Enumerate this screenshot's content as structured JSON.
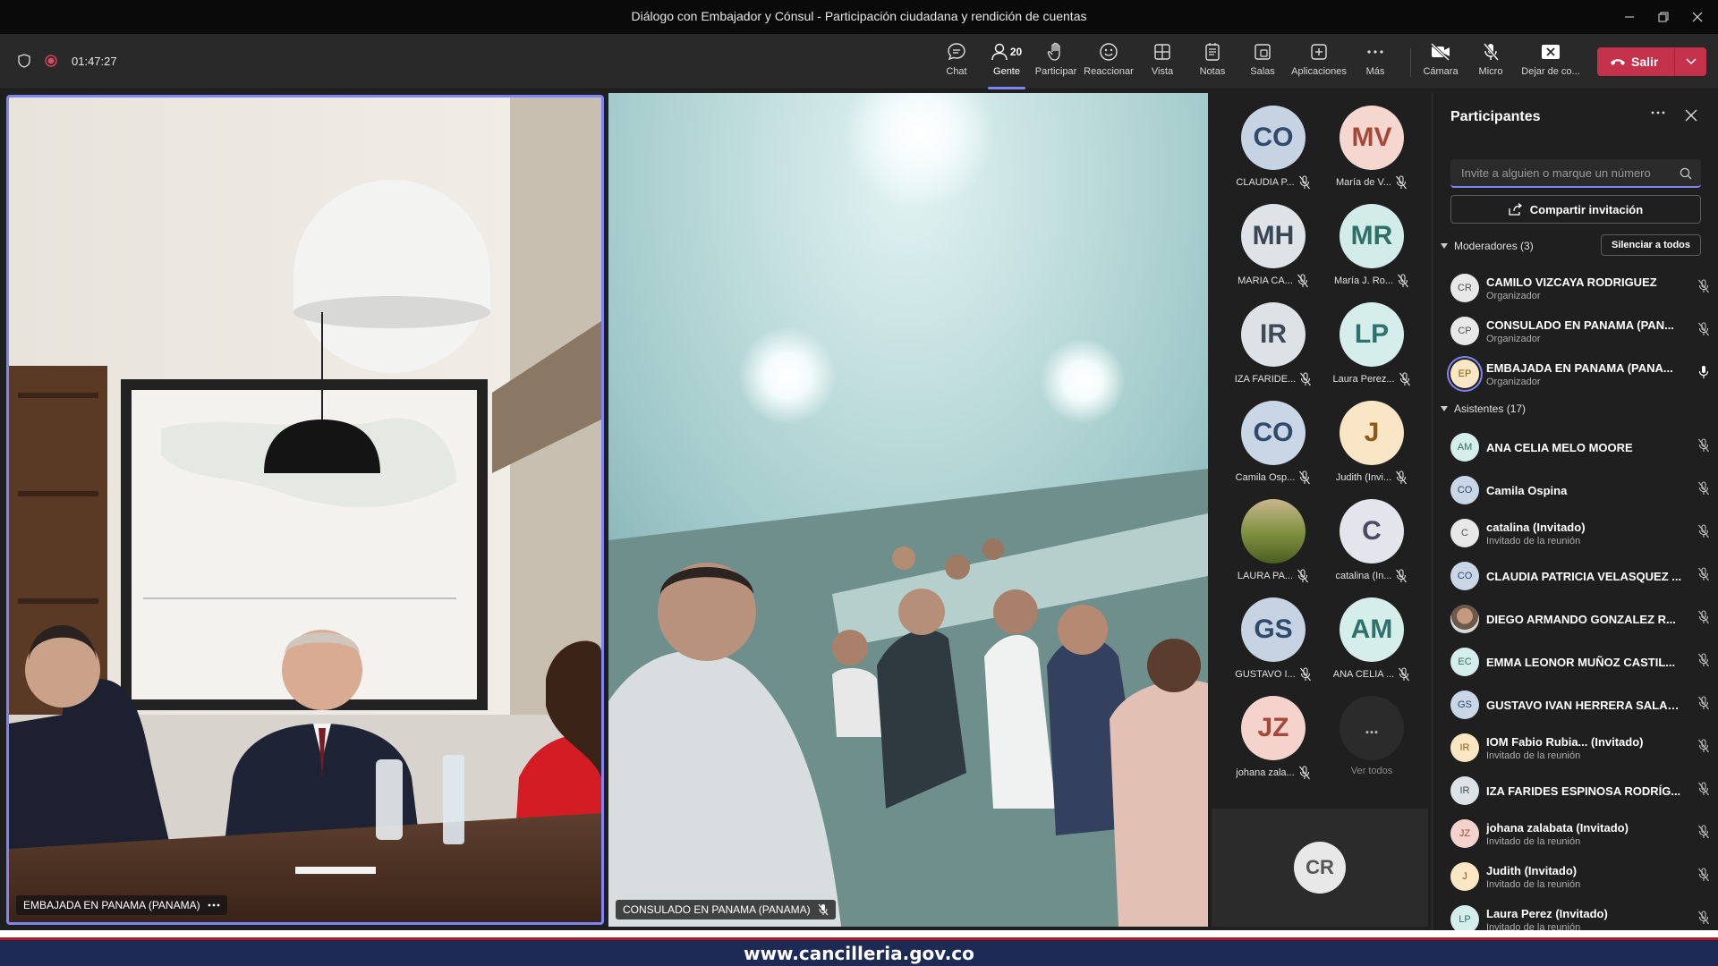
{
  "window": {
    "title": "Diálogo con Embajador y Cónsul - Participación ciudadana y rendición de cuentas"
  },
  "meeting": {
    "timer": "01:47:27"
  },
  "toolbar": {
    "chat": "Chat",
    "people": "Gente",
    "people_count": "20",
    "raise_hand": "Participar",
    "react": "Reaccionar",
    "view": "Vista",
    "notes": "Notas",
    "rooms": "Salas",
    "apps": "Aplicaciones",
    "more": "Más",
    "camera": "Cámara",
    "mic": "Micro",
    "share": "Dejar de co...",
    "leave": "Salir",
    "leave_color": "#c4314b",
    "accent": "#7f85f5"
  },
  "videos": {
    "left_name": "EMBAJADA EN PANAMA (PANAMA)",
    "center_name": "CONSULADO EN PANAMA (PANAMA)"
  },
  "gallery": {
    "tiles": [
      {
        "initials": "CO",
        "name": "CLAUDIA P...",
        "bg": "#c6d3e3",
        "fg": "#2f4a6b"
      },
      {
        "initials": "MV",
        "name": "María de V...",
        "bg": "#f5d7d0",
        "fg": "#a4493a"
      },
      {
        "initials": "MH",
        "name": "MARIA CA...",
        "bg": "#dfe3e8",
        "fg": "#3b4654"
      },
      {
        "initials": "MR",
        "name": "María J. Ro...",
        "bg": "#d2ede9",
        "fg": "#2f6f66"
      },
      {
        "initials": "IR",
        "name": "IZA FARIDE...",
        "bg": "#dde2e7",
        "fg": "#3f4a56"
      },
      {
        "initials": "LP",
        "name": "Laura Perez...",
        "bg": "#d5eeec",
        "fg": "#2f716c"
      },
      {
        "initials": "CO",
        "name": "Camila Osp...",
        "bg": "#c8d6e6",
        "fg": "#2f4a6b"
      },
      {
        "initials": "J",
        "name": "Judith (Invi...",
        "bg": "#f8e6c7",
        "fg": "#8a5a16"
      },
      {
        "initials": "",
        "name": "LAURA PA...",
        "bg": "#6f7a3a",
        "fg": "#ffffff"
      },
      {
        "initials": "C",
        "name": "catalina (In...",
        "bg": "#e4e4ec",
        "fg": "#4b4b5e"
      },
      {
        "initials": "GS",
        "name": "GUSTAVO I...",
        "bg": "#c6d3e3",
        "fg": "#2f4a6b"
      },
      {
        "initials": "AM",
        "name": "ANA CELIA ...",
        "bg": "#d5eeea",
        "fg": "#2f716a"
      },
      {
        "initials": "JZ",
        "name": "johana zala...",
        "bg": "#f4d3cd",
        "fg": "#a4493a"
      },
      {
        "initials": "...",
        "name": "Ver todos",
        "bg": "#2b2b2b",
        "fg": "#bdbdbd"
      }
    ],
    "self_initials": "CR"
  },
  "panel": {
    "title": "Participantes",
    "search_placeholder": "Invite a alguien o marque un número",
    "share_invite": "Compartir invitación",
    "moderators_header": "Moderadores (3)",
    "mute_all": "Silenciar a todos",
    "attendees_header": "Asistentes (17)",
    "moderators": [
      {
        "initials": "CR",
        "name": "CAMILO VIZCAYA RODRIGUEZ",
        "role": "Organizador",
        "bg": "#e8e8e8",
        "fg": "#555"
      },
      {
        "initials": "CP",
        "name": "CONSULADO EN PANAMA (PAN...",
        "role": "Organizador",
        "bg": "#e8e8e8",
        "fg": "#555"
      },
      {
        "initials": "EP",
        "name": "EMBAJADA EN PANAMA (PANA...",
        "role": "Organizador",
        "bg": "#fbe7c4",
        "fg": "#8a5a16"
      }
    ],
    "attendees": [
      {
        "initials": "AM",
        "name": "ANA CELIA MELO MOORE",
        "role": "",
        "bg": "#d5eeea",
        "fg": "#2f716a"
      },
      {
        "initials": "CO",
        "name": "Camila Ospina",
        "role": "",
        "bg": "#c8d6e6",
        "fg": "#2f4a6b"
      },
      {
        "initials": "C",
        "name": "catalina (Invitado)",
        "role": "Invitado de la reunión",
        "bg": "#e8e8e8",
        "fg": "#555"
      },
      {
        "initials": "CO",
        "name": "CLAUDIA PATRICIA VELASQUEZ ...",
        "role": "",
        "bg": "#c8d6e6",
        "fg": "#2f4a6b"
      },
      {
        "initials": "",
        "name": "DIEGO ARMANDO GONZALEZ R...",
        "role": "",
        "bg": "#9a8a7a",
        "fg": "#fff"
      },
      {
        "initials": "EC",
        "name": "EMMA LEONOR MUÑOZ CASTIL...",
        "role": "",
        "bg": "#d5eeea",
        "fg": "#2f716a"
      },
      {
        "initials": "GS",
        "name": "GUSTAVO IVAN HERRERA SALAZ...",
        "role": "",
        "bg": "#c8d6e6",
        "fg": "#2f4a6b"
      },
      {
        "initials": "IR",
        "name": "IOM Fabio Rubia... (Invitado)",
        "role": "Invitado de la reunión",
        "bg": "#fbe7c4",
        "fg": "#8a5a16"
      },
      {
        "initials": "IR",
        "name": "IZA FARIDES ESPINOSA RODRÍG...",
        "role": "",
        "bg": "#dde2e7",
        "fg": "#3f4a56"
      },
      {
        "initials": "JZ",
        "name": "johana zalabata (Invitado)",
        "role": "Invitado de la reunión",
        "bg": "#f4d3cd",
        "fg": "#a4493a"
      },
      {
        "initials": "J",
        "name": "Judith (Invitado)",
        "role": "Invitado de la reunión",
        "bg": "#fbe7c4",
        "fg": "#8a5a16"
      },
      {
        "initials": "LP",
        "name": "Laura Perez (Invitado)",
        "role": "Invitado de la reunión",
        "bg": "#d5eeec",
        "fg": "#2f716c"
      }
    ]
  },
  "footer": {
    "url": "www.cancilleria.gov.co"
  }
}
